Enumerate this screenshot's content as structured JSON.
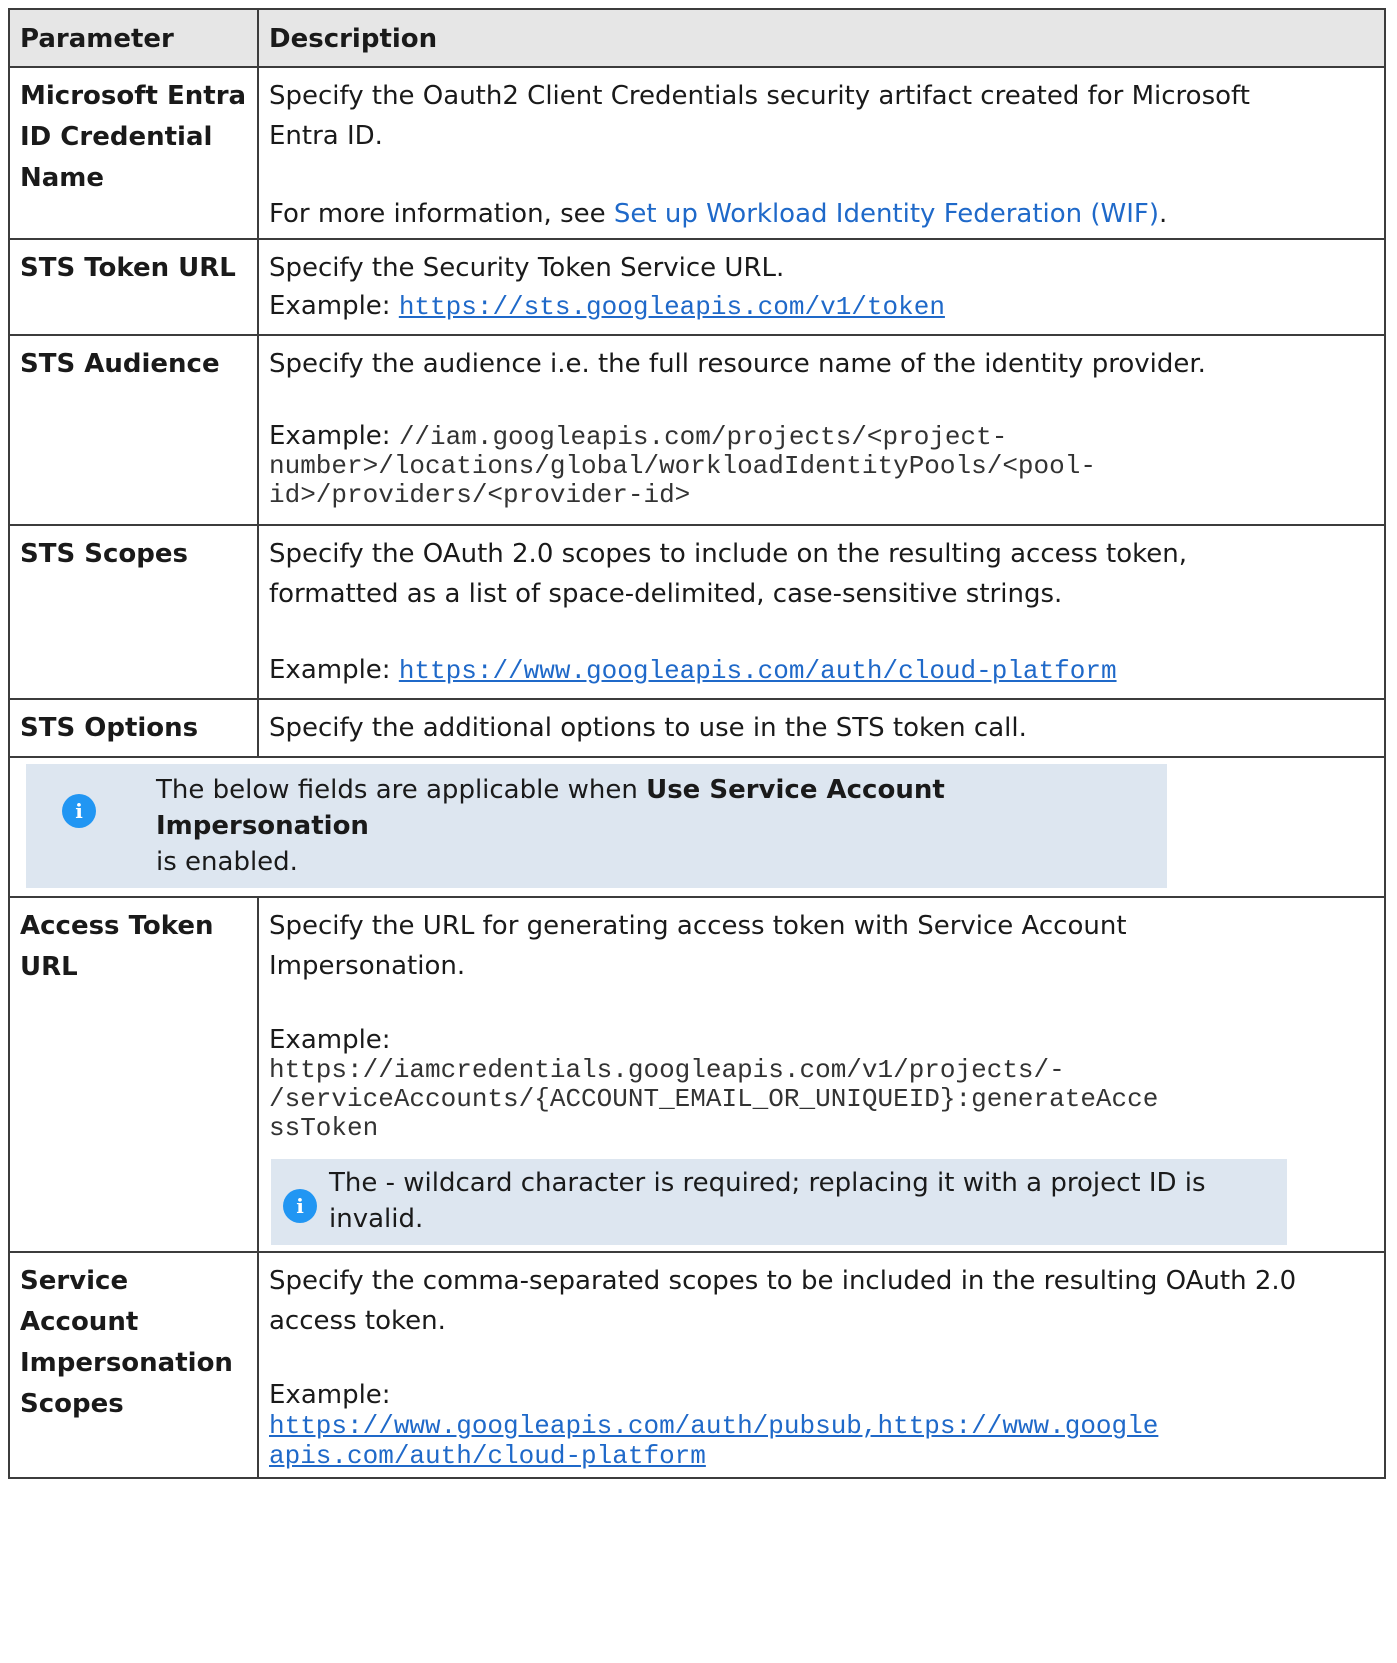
{
  "headers": {
    "parameter": "Parameter",
    "description": "Description"
  },
  "rows": {
    "entra": {
      "name": "Microsoft Entra ID Credential Name",
      "desc": "Specify the Oauth2 Client Credentials security artifact created for Microsoft Entra ID.",
      "more_prefix": "For more information, see ",
      "more_link": "Set up Workload Identity Federation (WIF)",
      "more_suffix": "."
    },
    "sts_url": {
      "name": "STS Token URL",
      "desc": "Specify the Security Token Service URL.",
      "example_label": "Example: ",
      "example_link": "https://sts.googleapis.com/v1/token"
    },
    "sts_audience": {
      "name": "STS Audience",
      "desc": "Specify the audience i.e. the full resource name of the identity provider.",
      "example_label": "Example: ",
      "example_code_1": "//iam.googleapis.com/projects/<project-",
      "example_code_2": "number>/locations/global/workloadIdentityPools/<pool-",
      "example_code_3": "id>/providers/<provider-id>"
    },
    "sts_scopes": {
      "name": "STS Scopes",
      "desc_1": "Specify the OAuth 2.0 scopes to include on the resulting access token,",
      "desc_2": "formatted as a list of space-delimited, case-sensitive strings.",
      "example_label": "Example: ",
      "example_link": "https://www.googleapis.com/auth/cloud-platform"
    },
    "sts_options": {
      "name": "STS Options",
      "desc": "Specify the additional options to use in the STS token call."
    },
    "note": {
      "prefix": "The below fields are applicable when ",
      "bold": "Use Service Account Impersonation",
      "suffix": "is enabled."
    },
    "access_token": {
      "name": "Access Token URL",
      "desc": "Specify the URL for generating access token with Service Account Impersonation.",
      "example_label": "Example:",
      "example_code_1": "https://iamcredentials.googleapis.com/v1/projects/-",
      "example_code_2": "/serviceAccounts/{ACCOUNT_EMAIL_OR_UNIQUEID}:generateAcce",
      "example_code_3": "ssToken",
      "note": "The - wildcard character is required; replacing it with a project ID is invalid."
    },
    "sa_scopes": {
      "name": "Service Account Impersonation Scopes",
      "desc": "Specify the comma-separated scopes to be included in the resulting OAuth 2.0 access token.",
      "example_label": "Example:",
      "example_link_1": "https://www.googleapis.com/auth/pubsub,https://www.google",
      "example_link_2": "apis.com/auth/cloud-platform"
    }
  },
  "icons": {
    "info": "info-icon",
    "info_glyph": "i"
  },
  "colors": {
    "link": "#1f69c9",
    "note_bg": "#dde6f0",
    "header_bg": "#e6e6e6",
    "info_icon": "#2196f3"
  }
}
